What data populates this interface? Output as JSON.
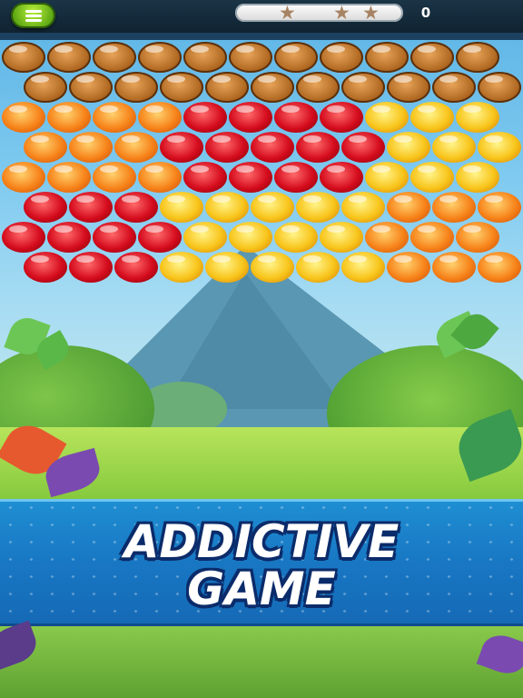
{
  "hud": {
    "menu_icon": "hamburger-menu-icon",
    "stars": {
      "total": 3,
      "icon": "star-icon",
      "color": "#a88363"
    },
    "score": "0"
  },
  "board": {
    "colors": {
      "wood": "#b26a23",
      "orange": "#f7831a",
      "red": "#d50c1d",
      "yellow": "#f8c41a"
    },
    "rows": [
      [
        "wood",
        "wood",
        "wood",
        "wood",
        "wood",
        "wood",
        "wood",
        "wood",
        "wood",
        "wood",
        "wood"
      ],
      [
        "wood",
        "wood",
        "wood",
        "wood",
        "wood",
        "wood",
        "wood",
        "wood",
        "wood",
        "wood",
        "wood"
      ],
      [
        "orange",
        "orange",
        "orange",
        "orange",
        "red",
        "red",
        "red",
        "red",
        "yellow",
        "yellow",
        "yellow"
      ],
      [
        "orange",
        "orange",
        "orange",
        "red",
        "red",
        "red",
        "red",
        "red",
        "yellow",
        "yellow",
        "yellow"
      ],
      [
        "orange",
        "orange",
        "orange",
        "orange",
        "red",
        "red",
        "red",
        "red",
        "yellow",
        "yellow",
        "yellow"
      ],
      [
        "red",
        "red",
        "red",
        "yellow",
        "yellow",
        "yellow",
        "yellow",
        "yellow",
        "orange",
        "orange",
        "orange"
      ],
      [
        "red",
        "red",
        "red",
        "red",
        "yellow",
        "yellow",
        "yellow",
        "yellow",
        "orange",
        "orange",
        "orange"
      ],
      [
        "red",
        "red",
        "red",
        "yellow",
        "yellow",
        "yellow",
        "yellow",
        "yellow",
        "orange",
        "orange",
        "orange"
      ]
    ]
  },
  "banner": {
    "line1": "ADDICTIVE",
    "line2": "GAME"
  }
}
